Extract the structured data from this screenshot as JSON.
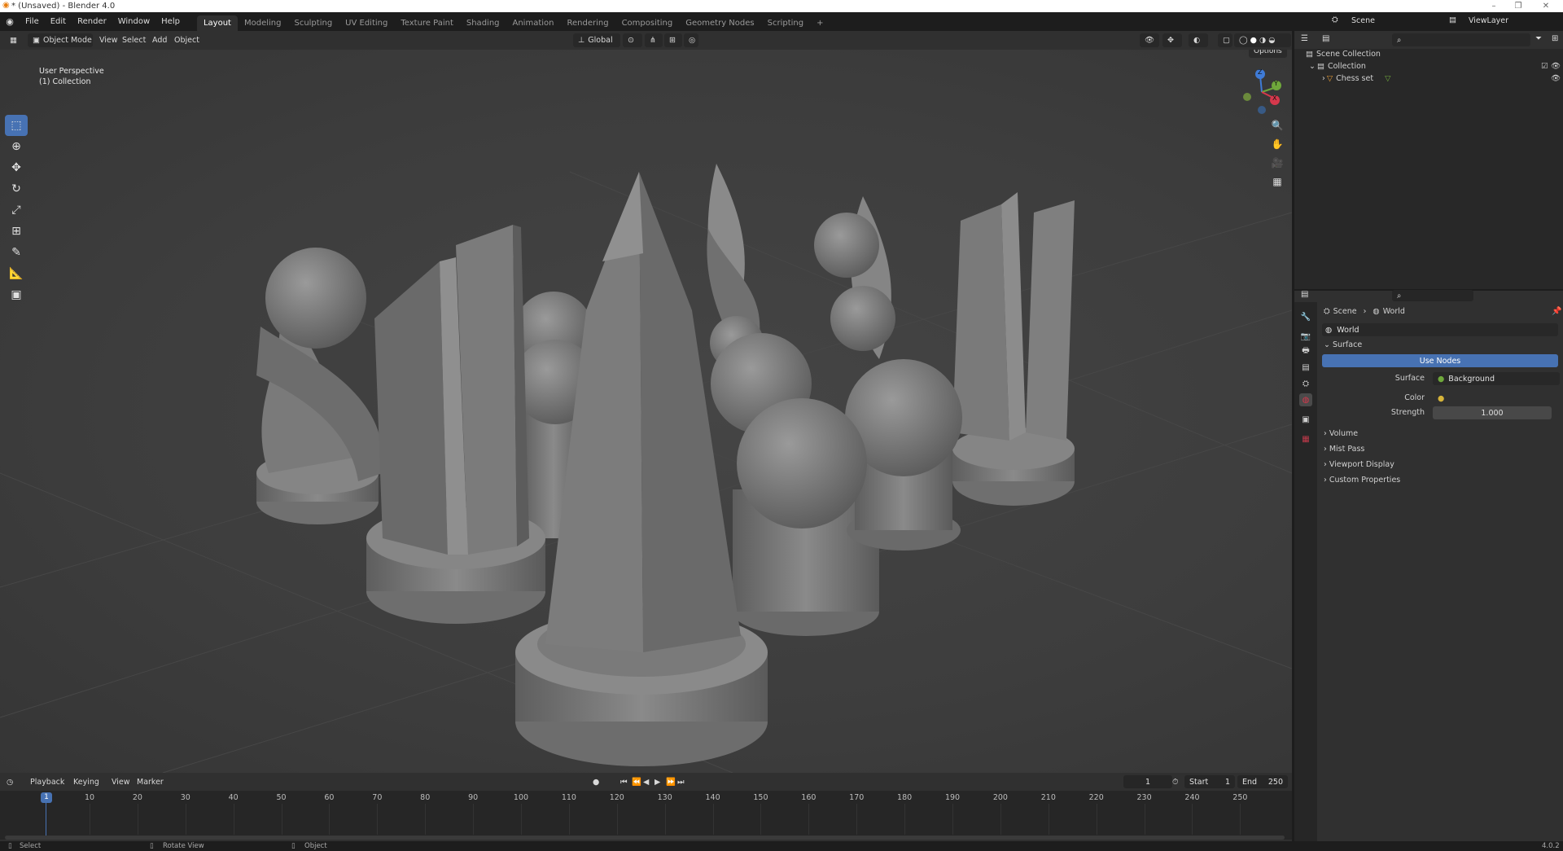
{
  "app": {
    "title": "* (Unsaved) - Blender 4.0",
    "version": "4.0.2"
  },
  "menu": {
    "items": [
      "File",
      "Edit",
      "Render",
      "Window",
      "Help"
    ]
  },
  "workspaces": {
    "tabs": [
      "Layout",
      "Modeling",
      "Sculpting",
      "UV Editing",
      "Texture Paint",
      "Shading",
      "Animation",
      "Rendering",
      "Compositing",
      "Geometry Nodes",
      "Scripting"
    ],
    "add": "+"
  },
  "top_right": {
    "scene": "Scene",
    "view_layer": "ViewLayer"
  },
  "viewport_header": {
    "mode": "Object Mode",
    "menus": [
      "View",
      "Select",
      "Add",
      "Object"
    ],
    "orientation": "Global",
    "options": "Options"
  },
  "viewport": {
    "perspective": "User Perspective",
    "collection": "(1) Collection"
  },
  "gizmo": {
    "z": "Z",
    "y": "Y",
    "x": "X"
  },
  "outliner": {
    "rows": [
      {
        "label": "Scene Collection"
      },
      {
        "label": "Collection"
      },
      {
        "label": "Chess set"
      }
    ]
  },
  "properties": {
    "breadcrumb": {
      "scene": "Scene",
      "world": "World"
    },
    "world_name": "World",
    "surface_panel": "Surface",
    "use_nodes": "Use Nodes",
    "surface_label": "Surface",
    "surface_value": "Background",
    "color_label": "Color",
    "strength_label": "Strength",
    "strength_value": "1.000",
    "panels": [
      "Volume",
      "Mist Pass",
      "Viewport Display",
      "Custom Properties"
    ]
  },
  "timeline": {
    "menus": [
      "Playback",
      "Keying",
      "View",
      "Marker"
    ],
    "current_frame": "1",
    "start_label": "Start",
    "start": "1",
    "end_label": "End",
    "end": "250",
    "ticks": [
      "1",
      "10",
      "20",
      "30",
      "40",
      "50",
      "60",
      "70",
      "80",
      "90",
      "100",
      "110",
      "120",
      "130",
      "140",
      "150",
      "160",
      "170",
      "180",
      "190",
      "200",
      "210",
      "220",
      "230",
      "240",
      "250"
    ],
    "playhead": "1"
  },
  "status": {
    "select": "Select",
    "rotate": "Rotate View",
    "object": "Object",
    "version": "4.0.2"
  },
  "colors": {
    "accent": "#4772b3",
    "x_axis": "#d6384c",
    "y_axis": "#6fa83b",
    "z_axis": "#3f7bd6"
  }
}
